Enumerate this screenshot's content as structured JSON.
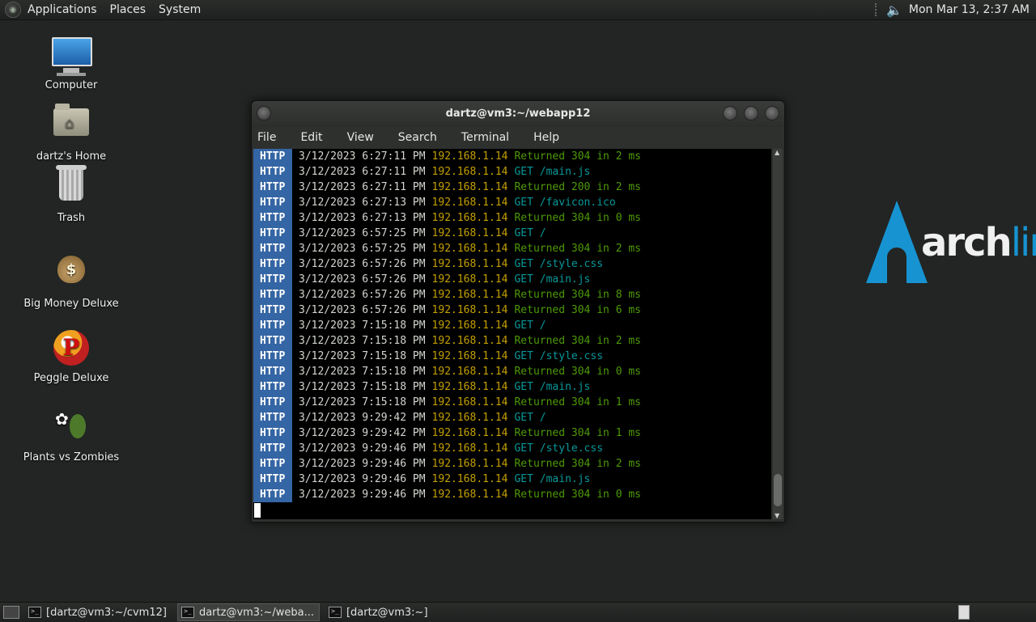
{
  "top_panel": {
    "menus": [
      "Applications",
      "Places",
      "System"
    ],
    "clock": "Mon Mar 13,  2:37 AM",
    "icons": {
      "logo": "gnome-foot-icon",
      "volume": "speaker-icon"
    }
  },
  "desktop_icons": [
    {
      "label": "Computer",
      "icon": "computer-icon"
    },
    {
      "label": "dartz's Home",
      "icon": "home-folder-icon"
    },
    {
      "label": "Trash",
      "icon": "trash-icon"
    },
    {
      "label": "Big Money Deluxe",
      "icon": "money-bag-icon"
    },
    {
      "label": "Peggle Deluxe",
      "icon": "peggle-icon"
    },
    {
      "label": "Plants vs Zombies",
      "icon": "plants-vs-zombies-icon"
    }
  ],
  "terminal": {
    "title": "dartz@vm3:~/webapp12",
    "menu": [
      "File",
      "Edit",
      "View",
      "Search",
      "Terminal",
      "Help"
    ],
    "lines": [
      {
        "tag": "HTTP",
        "ts": "3/12/2023 6:27:11 PM",
        "ip": "192.168.1.14",
        "msg": "Returned 304 in 2 ms",
        "kind": "ret"
      },
      {
        "tag": "HTTP",
        "ts": "3/12/2023 6:27:11 PM",
        "ip": "192.168.1.14",
        "msg": "GET /main.js",
        "kind": "get"
      },
      {
        "tag": "HTTP",
        "ts": "3/12/2023 6:27:11 PM",
        "ip": "192.168.1.14",
        "msg": "Returned 200 in 2 ms",
        "kind": "ret"
      },
      {
        "tag": "HTTP",
        "ts": "3/12/2023 6:27:13 PM",
        "ip": "192.168.1.14",
        "msg": "GET /favicon.ico",
        "kind": "get"
      },
      {
        "tag": "HTTP",
        "ts": "3/12/2023 6:27:13 PM",
        "ip": "192.168.1.14",
        "msg": "Returned 304 in 0 ms",
        "kind": "ret"
      },
      {
        "tag": "HTTP",
        "ts": "3/12/2023 6:57:25 PM",
        "ip": "192.168.1.14",
        "msg": "GET /",
        "kind": "get"
      },
      {
        "tag": "HTTP",
        "ts": "3/12/2023 6:57:25 PM",
        "ip": "192.168.1.14",
        "msg": "Returned 304 in 2 ms",
        "kind": "ret"
      },
      {
        "tag": "HTTP",
        "ts": "3/12/2023 6:57:26 PM",
        "ip": "192.168.1.14",
        "msg": "GET /style.css",
        "kind": "get"
      },
      {
        "tag": "HTTP",
        "ts": "3/12/2023 6:57:26 PM",
        "ip": "192.168.1.14",
        "msg": "GET /main.js",
        "kind": "get"
      },
      {
        "tag": "HTTP",
        "ts": "3/12/2023 6:57:26 PM",
        "ip": "192.168.1.14",
        "msg": "Returned 304 in 8 ms",
        "kind": "ret"
      },
      {
        "tag": "HTTP",
        "ts": "3/12/2023 6:57:26 PM",
        "ip": "192.168.1.14",
        "msg": "Returned 304 in 6 ms",
        "kind": "ret"
      },
      {
        "tag": "HTTP",
        "ts": "3/12/2023 7:15:18 PM",
        "ip": "192.168.1.14",
        "msg": "GET /",
        "kind": "get"
      },
      {
        "tag": "HTTP",
        "ts": "3/12/2023 7:15:18 PM",
        "ip": "192.168.1.14",
        "msg": "Returned 304 in 2 ms",
        "kind": "ret"
      },
      {
        "tag": "HTTP",
        "ts": "3/12/2023 7:15:18 PM",
        "ip": "192.168.1.14",
        "msg": "GET /style.css",
        "kind": "get"
      },
      {
        "tag": "HTTP",
        "ts": "3/12/2023 7:15:18 PM",
        "ip": "192.168.1.14",
        "msg": "Returned 304 in 0 ms",
        "kind": "ret"
      },
      {
        "tag": "HTTP",
        "ts": "3/12/2023 7:15:18 PM",
        "ip": "192.168.1.14",
        "msg": "GET /main.js",
        "kind": "get"
      },
      {
        "tag": "HTTP",
        "ts": "3/12/2023 7:15:18 PM",
        "ip": "192.168.1.14",
        "msg": "Returned 304 in 1 ms",
        "kind": "ret"
      },
      {
        "tag": "HTTP",
        "ts": "3/12/2023 9:29:42 PM",
        "ip": "192.168.1.14",
        "msg": "GET /",
        "kind": "get"
      },
      {
        "tag": "HTTP",
        "ts": "3/12/2023 9:29:42 PM",
        "ip": "192.168.1.14",
        "msg": "Returned 304 in 1 ms",
        "kind": "ret"
      },
      {
        "tag": "HTTP",
        "ts": "3/12/2023 9:29:46 PM",
        "ip": "192.168.1.14",
        "msg": "GET /style.css",
        "kind": "get"
      },
      {
        "tag": "HTTP",
        "ts": "3/12/2023 9:29:46 PM",
        "ip": "192.168.1.14",
        "msg": "Returned 304 in 2 ms",
        "kind": "ret"
      },
      {
        "tag": "HTTP",
        "ts": "3/12/2023 9:29:46 PM",
        "ip": "192.168.1.14",
        "msg": "GET /main.js",
        "kind": "get"
      },
      {
        "tag": "HTTP",
        "ts": "3/12/2023 9:29:46 PM",
        "ip": "192.168.1.14",
        "msg": "Returned 304 in 0 ms",
        "kind": "ret"
      }
    ]
  },
  "wallpaper": {
    "logo_text_main": "arch",
    "logo_text_accent": "lin",
    "accent_color": "#1793d1"
  },
  "taskbar": {
    "tasks": [
      {
        "label": "[dartz@vm3:~/cvm12]",
        "active": false
      },
      {
        "label": "dartz@vm3:~/weba...",
        "active": true
      },
      {
        "label": "[dartz@vm3:~]",
        "active": false
      }
    ]
  },
  "colors": {
    "desktop_bg": "#222523",
    "http_tag": "#3465a4",
    "ip": "#c4a000",
    "returned": "#4e9a06",
    "get": "#06989a"
  }
}
